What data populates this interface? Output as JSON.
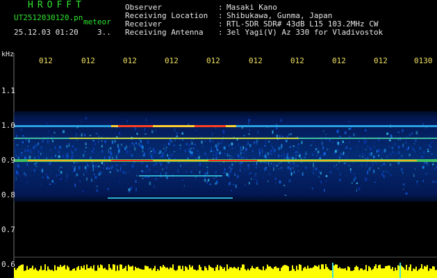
{
  "header": {
    "brand": "HROFFT",
    "file": "UT2512030120.pn",
    "tag": "meteor",
    "datetime": "25.12.03 01:20",
    "frame": "3..",
    "rows": [
      {
        "label": "Observer",
        "value": "Masaki Kano"
      },
      {
        "label": "Receiving Location",
        "value": "Shibukawa, Gunma, Japan"
      },
      {
        "label": "Receiver",
        "value": "RTL-SDR SDR# 43dB L15 103.2MHz CW"
      },
      {
        "label": "Receiving Antenna",
        "value": "3el Yagi(V) Az 330 for Vladivostok"
      }
    ],
    "colon": ":"
  },
  "axes": {
    "freq_unit": "kHz",
    "freq_ticks": [
      "1.1",
      "1.0",
      "0.9",
      "0.8",
      "0.7",
      "0.6"
    ],
    "time_ticks": [
      "012",
      "012",
      "012",
      "012",
      "012",
      "012",
      "012",
      "012",
      "012",
      "0130"
    ]
  },
  "colors": {
    "background": "#000000",
    "header_green": "#2ee62e",
    "tick_yellow": "#f0e060",
    "level_yellow": "#ffff00"
  }
}
